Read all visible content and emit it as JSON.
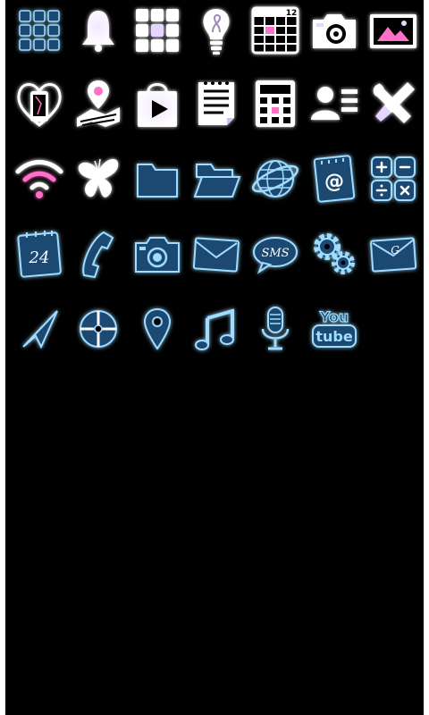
{
  "theme": {
    "background": "#000000",
    "white_icon_fill": "#ffffff",
    "white_icon_glow": "#d8c8ff",
    "blue_icon_fill": "#1d4a72",
    "blue_icon_stroke": "#9fdcff",
    "accent_pink": "#ff6fc8",
    "accent_lavender": "#e6d6ff"
  },
  "icons": [
    {
      "name": "app-drawer-grid-icon",
      "style": "blue"
    },
    {
      "name": "bell-icon",
      "style": "white"
    },
    {
      "name": "apps-grid-icon",
      "style": "white"
    },
    {
      "name": "lightbulb-icon",
      "style": "white"
    },
    {
      "name": "calendar-icon",
      "style": "white",
      "text": "12"
    },
    {
      "name": "camera-icon",
      "style": "white"
    },
    {
      "name": "gallery-icon",
      "style": "white"
    },
    {
      "name": "phone-heart-icon",
      "style": "white"
    },
    {
      "name": "maps-pin-icon",
      "style": "white"
    },
    {
      "name": "play-store-icon",
      "style": "white"
    },
    {
      "name": "notepad-icon",
      "style": "white"
    },
    {
      "name": "calculator-icon",
      "style": "white"
    },
    {
      "name": "contacts-icon",
      "style": "white"
    },
    {
      "name": "settings-tools-icon",
      "style": "white"
    },
    {
      "name": "wifi-icon",
      "style": "white"
    },
    {
      "name": "butterfly-icon",
      "style": "white"
    },
    {
      "name": "folder-icon",
      "style": "blue"
    },
    {
      "name": "folder-open-icon",
      "style": "blue"
    },
    {
      "name": "browser-globe-icon",
      "style": "blue"
    },
    {
      "name": "email-at-icon",
      "style": "blue",
      "text": "@"
    },
    {
      "name": "calculator-blue-icon",
      "style": "blue"
    },
    {
      "name": "calendar-24-icon",
      "style": "blue",
      "text": "24"
    },
    {
      "name": "phone-handset-icon",
      "style": "blue"
    },
    {
      "name": "camera-blue-icon",
      "style": "blue"
    },
    {
      "name": "mail-envelope-icon",
      "style": "blue"
    },
    {
      "name": "sms-bubble-icon",
      "style": "blue",
      "text": "SMS"
    },
    {
      "name": "gears-icon",
      "style": "blue"
    },
    {
      "name": "gmail-envelope-icon",
      "style": "blue",
      "text": "G"
    },
    {
      "name": "navigation-arrow-icon",
      "style": "blue"
    },
    {
      "name": "compass-icon",
      "style": "blue"
    },
    {
      "name": "location-pin-icon",
      "style": "blue"
    },
    {
      "name": "music-note-icon",
      "style": "blue"
    },
    {
      "name": "microphone-icon",
      "style": "blue"
    },
    {
      "name": "youtube-icon",
      "style": "blue",
      "text_top": "You",
      "text_bottom": "tube"
    }
  ]
}
